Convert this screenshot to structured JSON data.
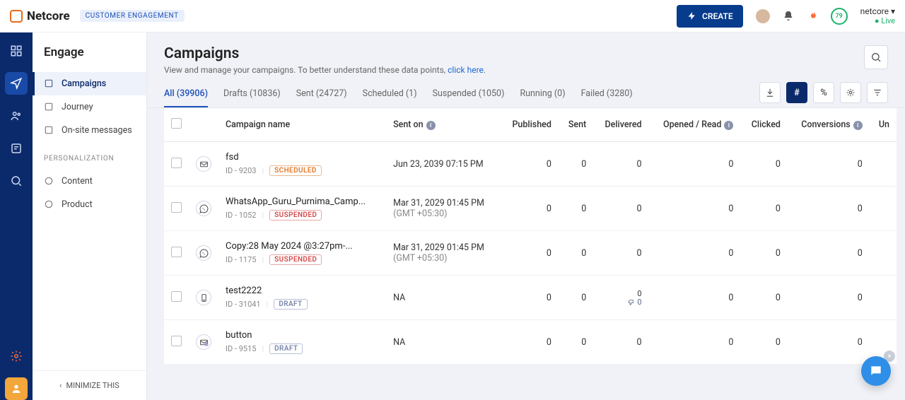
{
  "brand": {
    "name": "Netcore",
    "tag": "CUSTOMER ENGAGEMENT"
  },
  "header": {
    "create": "CREATE",
    "account_name": "netcore",
    "status": "Live",
    "score": "79"
  },
  "secondnav": {
    "title": "Engage",
    "items": [
      {
        "label": "Campaigns",
        "active": true
      },
      {
        "label": "Journey"
      },
      {
        "label": "On-site messages"
      }
    ],
    "pers_header": "PERSONALIZATION",
    "pers_items": [
      {
        "label": "Content"
      },
      {
        "label": "Product"
      }
    ],
    "minimize": "MINIMIZE THIS"
  },
  "page": {
    "title": "Campaigns",
    "subtitle_pre": "View and manage your campaigns. To better understand these data points, ",
    "subtitle_link": "click here",
    "subtitle_post": "."
  },
  "tabs": [
    {
      "label": "All (39906)",
      "active": true
    },
    {
      "label": "Drafts (10836)"
    },
    {
      "label": "Sent (24727)"
    },
    {
      "label": "Scheduled (1)"
    },
    {
      "label": "Suspended (1050)"
    },
    {
      "label": "Running (0)"
    },
    {
      "label": "Failed (3280)"
    }
  ],
  "toolbar": {
    "hash": "#",
    "pct": "%"
  },
  "columns": {
    "campaign": "Campaign name",
    "sent_on": "Sent on",
    "published": "Published",
    "sent": "Sent",
    "delivered": "Delivered",
    "opened": "Opened / Read",
    "clicked": "Clicked",
    "conversions": "Conversions",
    "un": "Un"
  },
  "rows": [
    {
      "name": "fsd",
      "id": "ID - 9203",
      "status": "SCHEDULED",
      "status_kind": "scheduled",
      "channel": "email",
      "sent_on": "Jun 23, 2039 07:15 PM",
      "published": "0",
      "sent": "0",
      "delivered": "0",
      "opened": "0",
      "clicked": "0",
      "conversions": "0"
    },
    {
      "name": "WhatsApp_Guru_Purnima_Camp...",
      "id": "ID - 1052",
      "status": "SUSPENDED",
      "status_kind": "suspended",
      "channel": "whatsapp",
      "sent_on": "Mar 31, 2029 01:45 PM",
      "sent_on2": "(GMT +05:30)",
      "published": "0",
      "sent": "0",
      "delivered": "0",
      "opened": "0",
      "clicked": "0",
      "conversions": "0"
    },
    {
      "name": "Copy:28 May 2024 @3:27pm-...",
      "id": "ID - 1175",
      "status": "SUSPENDED",
      "status_kind": "suspended",
      "channel": "whatsapp",
      "sent_on": "Mar 31, 2029 01:45 PM",
      "sent_on2": "(GMT +05:30)",
      "published": "0",
      "sent": "0",
      "delivered": "0",
      "opened": "0",
      "clicked": "0",
      "conversions": "0"
    },
    {
      "name": "test2222",
      "id": "ID - 31041",
      "status": "DRAFT",
      "status_kind": "draft",
      "channel": "sms",
      "sent_on": "NA",
      "published": "0",
      "sent": "0",
      "delivered_stack": [
        "0",
        "0"
      ],
      "opened": "0",
      "clicked": "0",
      "conversions": "0"
    },
    {
      "name": "button",
      "id": "ID - 9515",
      "status": "DRAFT",
      "status_kind": "draft",
      "channel": "email-plus",
      "sent_on": "NA",
      "published": "0",
      "sent": "0",
      "delivered": "0",
      "opened": "0",
      "clicked": "0",
      "conversions": "0"
    }
  ]
}
